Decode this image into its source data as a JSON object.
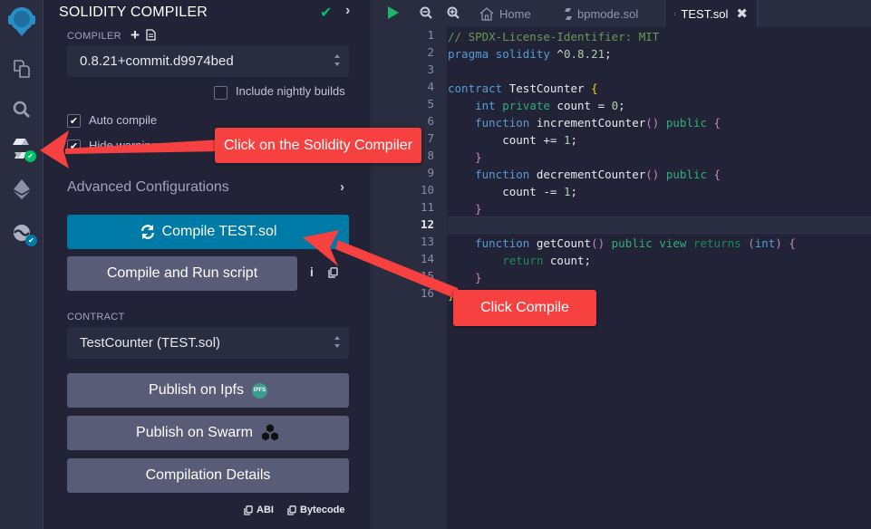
{
  "iconbar": {
    "items": [
      {
        "name": "remix-logo"
      },
      {
        "name": "file-explorer-icon"
      },
      {
        "name": "search-icon"
      },
      {
        "name": "solidity-compiler-icon",
        "badge": "check",
        "badge_color": "#00c16b"
      },
      {
        "name": "deploy-run-icon"
      },
      {
        "name": "solidity-analyzers-icon",
        "badge": "check",
        "badge_color": "#007aa6"
      }
    ]
  },
  "panel": {
    "title": "SOLIDITY COMPILER",
    "compiler_label": "COMPILER",
    "compiler_version": "0.8.21+commit.d9974bed",
    "include_nightly_label": "Include nightly builds",
    "include_nightly_checked": false,
    "auto_compile_label": "Auto compile",
    "auto_compile_checked": true,
    "hide_warnings_label": "Hide warnings",
    "hide_warnings_checked": true,
    "advanced_label": "Advanced Configurations",
    "compile_button": "Compile TEST.sol",
    "compile_run_button": "Compile and Run script",
    "contract_label": "CONTRACT",
    "contract_value": "TestCounter (TEST.sol)",
    "publish_ipfs": "Publish on Ipfs",
    "ipfs_badge": "IPFS",
    "publish_swarm": "Publish on Swarm",
    "compilation_details": "Compilation Details",
    "abi_label": "ABI",
    "bytecode_label": "Bytecode"
  },
  "editor": {
    "tabs": [
      {
        "label": "Home",
        "icon": "home-icon",
        "active": false
      },
      {
        "label": "bpmode.sol",
        "icon": "solidity-file-icon",
        "active": false
      },
      {
        "label": "TEST.sol",
        "icon": "solidity-file-icon",
        "active": true
      }
    ],
    "current_line": 12,
    "line_numbers": [
      "1",
      "2",
      "3",
      "4",
      "5",
      "6",
      "7",
      "8",
      "9",
      "10",
      "11",
      "12",
      "13",
      "14",
      "15",
      "16"
    ]
  },
  "callouts": {
    "solidity_compiler": "Click on the Solidity Compiler",
    "compile": "Click Compile"
  },
  "colors": {
    "accent": "#007aa6",
    "success": "#00c16b",
    "callout": "#f74040"
  }
}
